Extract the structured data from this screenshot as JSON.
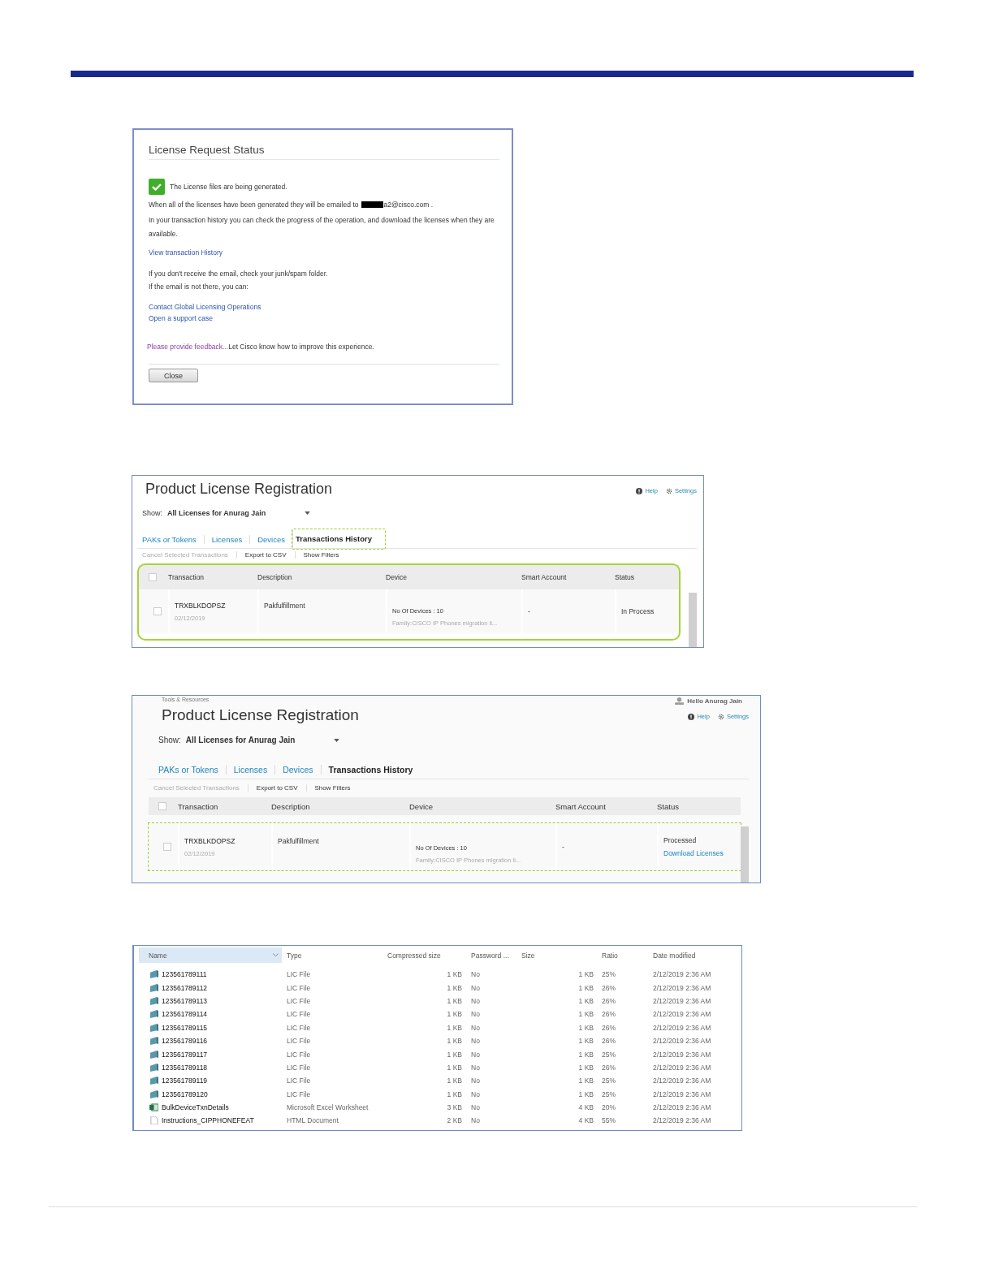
{
  "dialog": {
    "title": "License Request Status",
    "status_message": "The License files are being generated.",
    "email_line": "When all of the licenses have been generated they will be emailed to",
    "email": "a2@cisco.com .",
    "history_note": "In your transaction history you can check the progress of the operation, and download the licenses when they are available.",
    "history_link": "View transaction History",
    "junk_note": "If you don't receive the email, check your junk/spam folder.",
    "missing_note": "If the email is not there, you can:",
    "help_links": [
      "Contact Global Licensing Operations",
      "Open a support case"
    ],
    "feedback_link": "Please provide feedback...",
    "feedback_text": "Let Cisco know how to improve this experience.",
    "button": "Close"
  },
  "portals": [
    {
      "title": "Product License Registration",
      "help": "Help",
      "settings": "Settings",
      "show_label": "Show:",
      "show_value": "All Licenses for Anurag Jain",
      "table_highlighted": true,
      "tabs": [
        {
          "label": "PAKs or Tokens",
          "selected": false,
          "highlighted": false
        },
        {
          "label": "Licenses",
          "selected": false,
          "highlighted": false
        },
        {
          "label": "Devices",
          "selected": false,
          "highlighted": false
        },
        {
          "label": "Transactions History",
          "selected": true,
          "highlighted": true
        }
      ],
      "actions": [
        {
          "label": "Cancel Selected Transactions",
          "disabled": true
        },
        {
          "label": "Export to CSV",
          "disabled": false
        },
        {
          "label": "Show Filters",
          "disabled": false
        }
      ],
      "columns": [
        "Transaction",
        "Description",
        "Device",
        "Smart Account",
        "Status"
      ],
      "rows": [
        {
          "checked": false,
          "transaction": "TRXBLKDOPSZ",
          "date": "02/12/2019",
          "description": "Pakfulfillment",
          "devices": "No Of Devices : 10",
          "family": "Family:CISCO IP Phones migration li...",
          "smart_account": "-",
          "status": "In Process",
          "highlighted": false
        }
      ]
    },
    {
      "breadcrumb": "Tools & Resources",
      "user": "Hello Anurag Jain",
      "title": "Product License Registration",
      "help": "Help",
      "settings": "Settings",
      "show_label": "Show:",
      "show_value": "All Licenses for Anurag Jain",
      "table_highlighted": false,
      "tabs": [
        {
          "label": "PAKs or Tokens",
          "selected": false,
          "highlighted": false
        },
        {
          "label": "Licenses",
          "selected": false,
          "highlighted": false
        },
        {
          "label": "Devices",
          "selected": false,
          "highlighted": false
        },
        {
          "label": "Transactions History",
          "selected": true,
          "highlighted": false
        }
      ],
      "actions": [
        {
          "label": "Cancel Selected Transactions",
          "disabled": true
        },
        {
          "label": "Export to CSV",
          "disabled": false
        },
        {
          "label": "Show Filters",
          "disabled": false
        }
      ],
      "columns": [
        "Transaction",
        "Description",
        "Device",
        "Smart Account",
        "Status"
      ],
      "rows": [
        {
          "checked": false,
          "transaction": "TRXBLKDOPSZ",
          "date": "02/12/2019",
          "description": "Pakfulfillment",
          "devices": "No Of Devices : 10",
          "family": "Family:CISCO IP Phones migration li...",
          "smart_account": "-",
          "status": "Processed",
          "status_link": "Download Licenses",
          "highlighted": true
        }
      ]
    }
  ],
  "archive": {
    "columns": {
      "name": "Name",
      "type": "Type",
      "compressed": "Compressed size",
      "password": "Password ...",
      "size": "Size",
      "ratio": "Ratio",
      "date": "Date modified"
    },
    "rows": [
      {
        "kind": "lic",
        "name": "123561789111",
        "type": "LIC File",
        "compressed": "1 KB",
        "password": "No",
        "size": "1 KB",
        "ratio": "25%",
        "date": "2/12/2019 2:36 AM"
      },
      {
        "kind": "lic",
        "name": "123561789112",
        "type": "LIC File",
        "compressed": "1 KB",
        "password": "No",
        "size": "1 KB",
        "ratio": "26%",
        "date": "2/12/2019 2:36 AM"
      },
      {
        "kind": "lic",
        "name": "123561789113",
        "type": "LIC File",
        "compressed": "1 KB",
        "password": "No",
        "size": "1 KB",
        "ratio": "26%",
        "date": "2/12/2019 2:36 AM"
      },
      {
        "kind": "lic",
        "name": "123561789114",
        "type": "LIC File",
        "compressed": "1 KB",
        "password": "No",
        "size": "1 KB",
        "ratio": "26%",
        "date": "2/12/2019 2:36 AM"
      },
      {
        "kind": "lic",
        "name": "123561789115",
        "type": "LIC File",
        "compressed": "1 KB",
        "password": "No",
        "size": "1 KB",
        "ratio": "26%",
        "date": "2/12/2019 2:36 AM"
      },
      {
        "kind": "lic",
        "name": "123561789116",
        "type": "LIC File",
        "compressed": "1 KB",
        "password": "No",
        "size": "1 KB",
        "ratio": "26%",
        "date": "2/12/2019 2:36 AM"
      },
      {
        "kind": "lic",
        "name": "123561789117",
        "type": "LIC File",
        "compressed": "1 KB",
        "password": "No",
        "size": "1 KB",
        "ratio": "25%",
        "date": "2/12/2019 2:36 AM"
      },
      {
        "kind": "lic",
        "name": "123561789118",
        "type": "LIC File",
        "compressed": "1 KB",
        "password": "No",
        "size": "1 KB",
        "ratio": "26%",
        "date": "2/12/2019 2:36 AM"
      },
      {
        "kind": "lic",
        "name": "123561789119",
        "type": "LIC File",
        "compressed": "1 KB",
        "password": "No",
        "size": "1 KB",
        "ratio": "25%",
        "date": "2/12/2019 2:36 AM"
      },
      {
        "kind": "lic",
        "name": "123561789120",
        "type": "LIC File",
        "compressed": "1 KB",
        "password": "No",
        "size": "1 KB",
        "ratio": "25%",
        "date": "2/12/2019 2:36 AM"
      },
      {
        "kind": "excel",
        "name": "BulkDeviceTxnDetails",
        "type": "Microsoft Excel Worksheet",
        "compressed": "3 KB",
        "password": "No",
        "size": "4 KB",
        "ratio": "20%",
        "date": "2/12/2019 2:36 AM"
      },
      {
        "kind": "html",
        "name": "Instructions_CIPPHONEFEAT",
        "type": "HTML Document",
        "compressed": "2 KB",
        "password": "No",
        "size": "4 KB",
        "ratio": "55%",
        "date": "2/12/2019 2:36 AM"
      }
    ]
  }
}
